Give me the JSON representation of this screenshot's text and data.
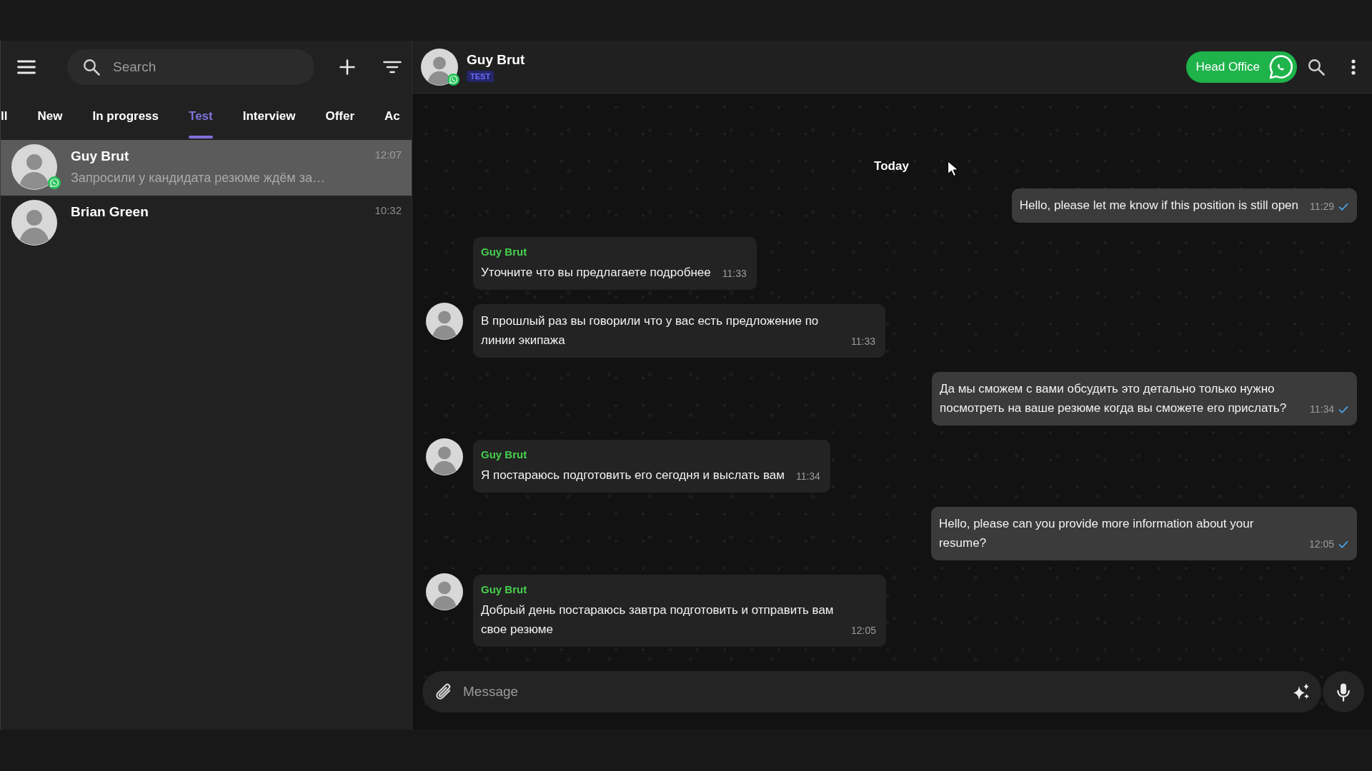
{
  "sidebar": {
    "search": {
      "placeholder": "Search"
    },
    "tabs": [
      {
        "label": "ll",
        "selected": false
      },
      {
        "label": "New",
        "selected": false
      },
      {
        "label": "In progress",
        "selected": false
      },
      {
        "label": "Test",
        "selected": true
      },
      {
        "label": "Interview",
        "selected": false
      },
      {
        "label": "Offer",
        "selected": false
      },
      {
        "label": "Ac",
        "selected": false
      }
    ],
    "chats": [
      {
        "name": "Guy Brut",
        "preview": "Запросили у кандидата резюме ждём за…",
        "time": "12:07",
        "messenger_badge": true,
        "selected": true
      },
      {
        "name": "Brian Green",
        "time": "10:32",
        "messenger_badge": false,
        "selected": false
      }
    ]
  },
  "conversation": {
    "header": {
      "name": "Guy Brut",
      "tag": "TEST",
      "messenger_badge": true,
      "channel_button": "Head Office"
    },
    "date_divider": "Today",
    "messages": [
      {
        "kind": "out",
        "text": "Hello, please let me know if this position is still open",
        "time": "11:29",
        "delivered": true
      },
      {
        "kind": "in",
        "sender": "Guy Brut",
        "avatar": false,
        "text": "Уточните что вы предлагаете подробнее",
        "time": "11:33"
      },
      {
        "kind": "in",
        "avatar": true,
        "text": "В прошлый раз вы говорили что у вас есть предложение по линии экипажа",
        "time": "11:33"
      },
      {
        "kind": "out",
        "text": "Да мы сможем с вами обсудить это детально только нужно посмотреть на ваше резюме когда вы сможете его прислать?",
        "time": "11:34",
        "delivered": true
      },
      {
        "kind": "in",
        "sender": "Guy Brut",
        "avatar": true,
        "text": "Я постараюсь подготовить его сегодня и выслать вам",
        "time": "11:34"
      },
      {
        "kind": "out",
        "text": "Hello, please can you provide more information about your resume?",
        "time": "12:05",
        "delivered": true
      },
      {
        "kind": "in",
        "sender": "Guy Brut",
        "avatar": true,
        "text": "Добрый день постараюсь завтра подготовить и отправить вам свое резюме",
        "time": "12:05"
      }
    ],
    "composer": {
      "placeholder": "Message"
    }
  }
}
